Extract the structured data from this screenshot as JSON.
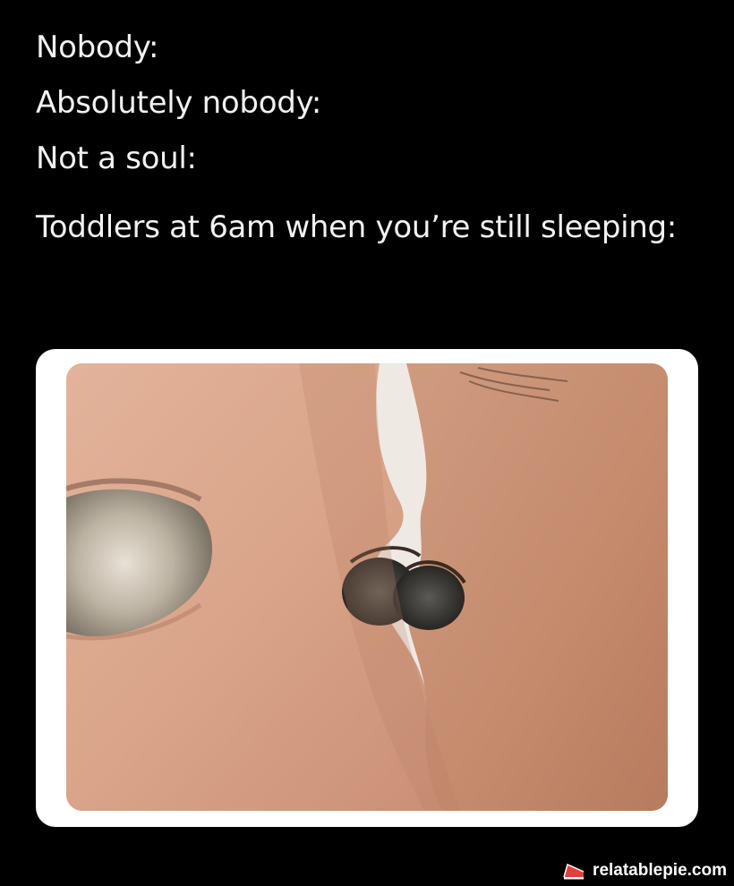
{
  "meme": {
    "lines": [
      "Nobody:",
      "Absolutely nobody:",
      "Not a soul:",
      "Toddlers at 6am when you’re still sleeping:"
    ]
  },
  "photo": {
    "description_icon": "two-faces-eye-to-eye-image"
  },
  "watermark": {
    "text": "relatablepie.com",
    "icon": "pie-slice-icon",
    "icon_color": "#e0413a"
  }
}
